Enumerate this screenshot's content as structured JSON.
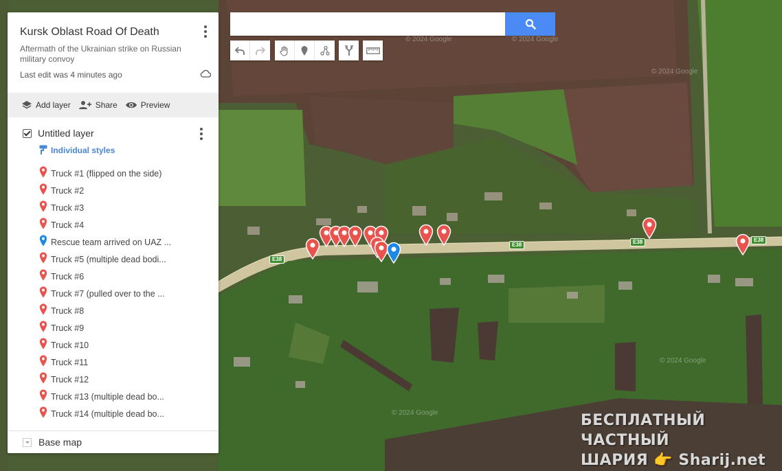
{
  "map_doc": {
    "title": "Kursk Oblast Road Of Death",
    "description": "Aftermath of the Ukrainian strike on Russian military convoy",
    "last_edit": "Last edit was 4 minutes ago"
  },
  "actions": {
    "add_layer": "Add layer",
    "share": "Share",
    "preview": "Preview"
  },
  "layer": {
    "name": "Untitled layer",
    "style": "Individual styles",
    "items": [
      {
        "label": "Truck #1 (flipped on the side)",
        "color": "#e8534e"
      },
      {
        "label": "Truck #2",
        "color": "#e8534e"
      },
      {
        "label": "Truck #3",
        "color": "#e8534e"
      },
      {
        "label": "Truck #4",
        "color": "#e8534e"
      },
      {
        "label": "Rescue team arrived on UAZ ...",
        "color": "#1e88e5"
      },
      {
        "label": "Truck #5 (multiple dead bodi...",
        "color": "#e8534e"
      },
      {
        "label": "Truck #6",
        "color": "#e8534e"
      },
      {
        "label": "Truck #7 (pulled over to the ...",
        "color": "#e8534e"
      },
      {
        "label": "Truck #8",
        "color": "#e8534e"
      },
      {
        "label": "Truck #9",
        "color": "#e8534e"
      },
      {
        "label": "Truck #10",
        "color": "#e8534e"
      },
      {
        "label": "Truck #11",
        "color": "#e8534e"
      },
      {
        "label": "Truck #12",
        "color": "#e8534e"
      },
      {
        "label": "Truck #13 (multiple dead bo...",
        "color": "#e8534e"
      },
      {
        "label": "Truck #14 (multiple dead bo...",
        "color": "#e8534e"
      }
    ]
  },
  "base_map": "Base map",
  "search": {
    "value": "",
    "placeholder": ""
  },
  "road_label": "E38",
  "imagery_credit": "© 2024 Google",
  "watermark": {
    "line1": "БЕСПЛАТНЫЙ ЧАСТНЫЙ",
    "line2": "ШАРИЯ 👉 Sharij.net"
  },
  "colors": {
    "marker_red": "#e8534e",
    "marker_blue": "#1e88e5",
    "accent": "#4a8af4"
  },
  "toolbar_icons": [
    "undo-icon",
    "redo-icon",
    "hand-icon",
    "add-marker-icon",
    "draw-line-icon",
    "directions-icon",
    "ruler-icon"
  ]
}
